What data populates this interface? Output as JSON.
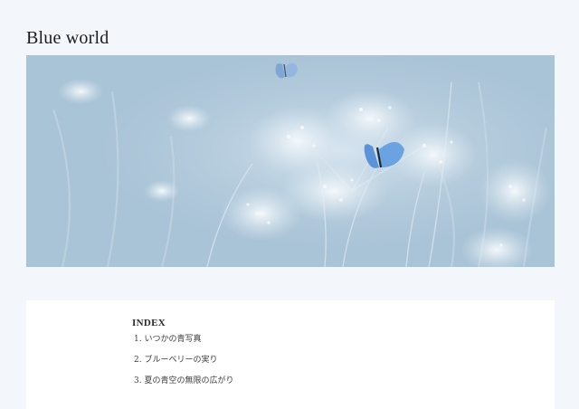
{
  "site": {
    "title": "Blue world"
  },
  "hero": {
    "subject": "pale blue flowers with blue butterflies"
  },
  "index": {
    "heading": "INDEX",
    "items": [
      {
        "label": "1. いつかの青写真"
      },
      {
        "label": "2. ブルーベリーの実り"
      },
      {
        "label": "3. 夏の青空の無限の広がり"
      }
    ]
  },
  "colors": {
    "page_background": "#f3f7fc",
    "card_background": "#ffffff",
    "hero_tint": "#a8c3d6",
    "butterfly_blue": "#5b93d8"
  }
}
